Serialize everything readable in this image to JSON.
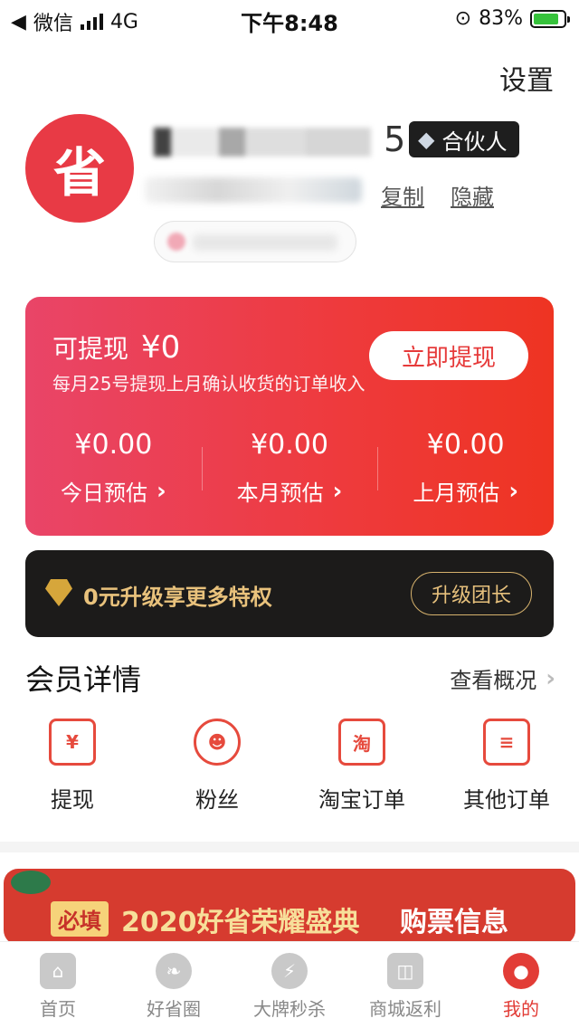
{
  "status_bar": {
    "carrier": "微信",
    "network": "4G",
    "time": "下午8:48",
    "battery": "83%",
    "battery_level": 0.83
  },
  "header": {
    "settings_label": "设置"
  },
  "profile": {
    "avatar_char": "省",
    "name_visible_end": "5",
    "badge": "合伙人",
    "copy": "复制",
    "hide": "隐藏"
  },
  "earnings": {
    "available_label": "可提现",
    "available_amount": "¥0",
    "note": "每月25号提现上月确认收货的订单收入",
    "withdraw_button": "立即提现",
    "stats": [
      {
        "value": "¥0.00",
        "label": "今日预估"
      },
      {
        "value": "¥0.00",
        "label": "本月预估"
      },
      {
        "value": "¥0.00",
        "label": "上月预估"
      }
    ]
  },
  "vip": {
    "text": "0元升级享更多特权",
    "button": "升级团长"
  },
  "member": {
    "title": "会员详情",
    "view_overview": "查看概况",
    "actions": [
      {
        "label": "提现",
        "icon": "yen-doc-icon",
        "glyph": "¥"
      },
      {
        "label": "粉丝",
        "icon": "fans-icon",
        "glyph": ""
      },
      {
        "label": "淘宝订单",
        "icon": "taobao-icon",
        "glyph": "淘"
      },
      {
        "label": "其他订单",
        "icon": "list-doc-icon",
        "glyph": "≡"
      }
    ]
  },
  "promo": {
    "tag": "必填",
    "title": "2020好省荣耀盛典",
    "cta": "购票信息"
  },
  "tabs": [
    {
      "label": "首页",
      "icon": "home-icon"
    },
    {
      "label": "好省圈",
      "icon": "leaf-icon"
    },
    {
      "label": "大牌秒杀",
      "icon": "alarm-icon"
    },
    {
      "label": "商城返利",
      "icon": "bag-icon"
    },
    {
      "label": "我的",
      "icon": "profile-icon"
    }
  ],
  "colors": {
    "accent": "#e23c36",
    "card_gradient_start": "#e94568",
    "card_gradient_end": "#ee3422",
    "vip_gold": "#e9c27c"
  }
}
